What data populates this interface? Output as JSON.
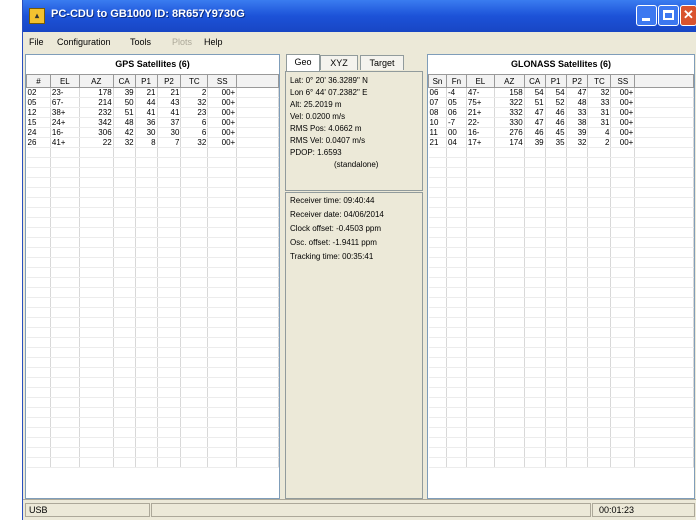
{
  "window": {
    "title": "PC-CDU to GB1000 ID: 8R657Y9730G",
    "app_icon": "gnss-app-icon",
    "controls": [
      "minimize-icon",
      "maximize-icon",
      "close-icon"
    ]
  },
  "menu": [
    "File",
    "Configuration",
    "Tools",
    "Plots",
    "Help"
  ],
  "gps": {
    "title": "GPS Satellites (6)",
    "columns": [
      "#",
      "EL",
      "AZ",
      "CA",
      "P1",
      "P2",
      "TC",
      "SS"
    ],
    "rows": [
      [
        "02",
        "23-",
        "178",
        "39",
        "21",
        "21",
        "2",
        "00+"
      ],
      [
        "05",
        "67-",
        "214",
        "50",
        "44",
        "43",
        "32",
        "00+"
      ],
      [
        "12",
        "38+",
        "232",
        "51",
        "41",
        "41",
        "23",
        "00+"
      ],
      [
        "15",
        "24+",
        "342",
        "48",
        "36",
        "37",
        "6",
        "00+"
      ],
      [
        "24",
        "16-",
        "306",
        "42",
        "30",
        "30",
        "6",
        "00+"
      ],
      [
        "26",
        "41+",
        "22",
        "32",
        "8",
        "7",
        "32",
        "00+"
      ]
    ]
  },
  "tabs": [
    "Geo",
    "XYZ",
    "Target"
  ],
  "geo": {
    "lat": "Lat: 0° 20' 36.3289\" N",
    "lon": "Lon 6° 44' 07.2382\" E",
    "alt": "Alt: 25.2019 m",
    "vel": "Vel: 0.0200 m/s",
    "rms_pos": "RMS Pos: 4.0662 m",
    "rms_vel": "RMS Vel: 0.0407 m/s",
    "pdop": "PDOP: 1.6593",
    "mode": "(standalone)"
  },
  "receiver": {
    "time": "Receiver time: 09:40:44",
    "date": "Receiver date: 04/06/2014",
    "clock": "Clock offset: -0.4503 ppm",
    "osc": "Osc. offset: -1.9411 ppm",
    "tracking": "Tracking time: 00:35:41"
  },
  "glonass": {
    "title": "GLONASS Satellites (6)",
    "columns": [
      "Sn",
      "Fn",
      "EL",
      "AZ",
      "CA",
      "P1",
      "P2",
      "TC",
      "SS"
    ],
    "rows": [
      [
        "06",
        "-4",
        "47-",
        "158",
        "54",
        "54",
        "47",
        "32",
        "00+"
      ],
      [
        "07",
        "05",
        "75+",
        "322",
        "51",
        "52",
        "48",
        "33",
        "00+"
      ],
      [
        "08",
        "06",
        "21+",
        "332",
        "47",
        "46",
        "33",
        "31",
        "00+"
      ],
      [
        "10",
        "-7",
        "22-",
        "330",
        "47",
        "46",
        "38",
        "31",
        "00+"
      ],
      [
        "11",
        "00",
        "16-",
        "276",
        "46",
        "45",
        "39",
        "4",
        "00+"
      ],
      [
        "21",
        "04",
        "17+",
        "174",
        "39",
        "35",
        "32",
        "2",
        "00+"
      ]
    ]
  },
  "status": {
    "port": "USB",
    "message": "",
    "elapsed": "00:01:23"
  }
}
